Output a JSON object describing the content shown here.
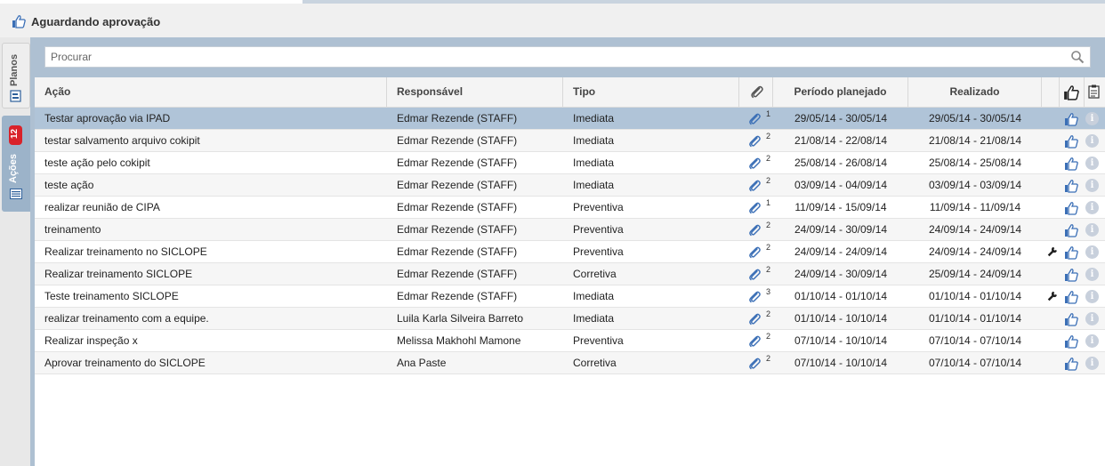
{
  "header": {
    "title": "Aguardando aprovação"
  },
  "sidebar": {
    "tabs": [
      {
        "label": "Planos",
        "icon": "plan-doc-icon",
        "active": false
      },
      {
        "label": "Ações",
        "badge": "12",
        "icon": "list-card-icon",
        "active": true
      }
    ]
  },
  "search": {
    "placeholder": "Procurar",
    "value": ""
  },
  "table": {
    "columns": {
      "acao": "Ação",
      "responsavel": "Responsável",
      "tipo": "Tipo",
      "anexo": "paperclip-icon",
      "periodo": "Período planejado",
      "realizado": "Realizado",
      "aprovar": "thumbs-up-icon",
      "relatorio": "clipboard-icon"
    },
    "rows": [
      {
        "acao": "Testar aprovação via IPAD",
        "responsavel": "Edmar Rezende (STAFF)",
        "tipo": "Imediata",
        "anexos": "1",
        "periodo": "29/05/14 - 30/05/14",
        "realizado": "29/05/14 - 30/05/14",
        "wrench": false,
        "selected": true
      },
      {
        "acao": "testar salvamento arquivo cokipit",
        "responsavel": "Edmar Rezende (STAFF)",
        "tipo": "Imediata",
        "anexos": "2",
        "periodo": "21/08/14 - 22/08/14",
        "realizado": "21/08/14 - 21/08/14",
        "wrench": false,
        "selected": false
      },
      {
        "acao": "teste ação pelo cokipit",
        "responsavel": "Edmar Rezende (STAFF)",
        "tipo": "Imediata",
        "anexos": "2",
        "periodo": "25/08/14 - 26/08/14",
        "realizado": "25/08/14 - 25/08/14",
        "wrench": false,
        "selected": false
      },
      {
        "acao": "teste ação",
        "responsavel": "Edmar Rezende (STAFF)",
        "tipo": "Imediata",
        "anexos": "2",
        "periodo": "03/09/14 - 04/09/14",
        "realizado": "03/09/14 - 03/09/14",
        "wrench": false,
        "selected": false
      },
      {
        "acao": "realizar reunião de CIPA",
        "responsavel": "Edmar Rezende (STAFF)",
        "tipo": "Preventiva",
        "anexos": "1",
        "periodo": "11/09/14 - 15/09/14",
        "realizado": "11/09/14 - 11/09/14",
        "wrench": false,
        "selected": false
      },
      {
        "acao": "treinamento",
        "responsavel": "Edmar Rezende (STAFF)",
        "tipo": "Preventiva",
        "anexos": "2",
        "periodo": "24/09/14 - 30/09/14",
        "realizado": "24/09/14 - 24/09/14",
        "wrench": false,
        "selected": false
      },
      {
        "acao": "Realizar treinamento no SICLOPE",
        "responsavel": "Edmar Rezende (STAFF)",
        "tipo": "Preventiva",
        "anexos": "2",
        "periodo": "24/09/14 - 24/09/14",
        "realizado": "24/09/14 - 24/09/14",
        "wrench": true,
        "selected": false
      },
      {
        "acao": "Realizar treinamento SICLOPE",
        "responsavel": "Edmar Rezende (STAFF)",
        "tipo": "Corretiva",
        "anexos": "2",
        "periodo": "24/09/14 - 30/09/14",
        "realizado": "25/09/14 - 24/09/14",
        "wrench": false,
        "selected": false
      },
      {
        "acao": "Teste treinamento SICLOPE",
        "responsavel": "Edmar Rezende (STAFF)",
        "tipo": "Imediata",
        "anexos": "3",
        "periodo": "01/10/14 - 01/10/14",
        "realizado": "01/10/14 - 01/10/14",
        "wrench": true,
        "selected": false
      },
      {
        "acao": "realizar treinamento com a equipe.",
        "responsavel": "Luila Karla Silveira Barreto",
        "tipo": "Imediata",
        "anexos": "2",
        "periodo": "01/10/14 - 10/10/14",
        "realizado": "01/10/14 - 01/10/14",
        "wrench": false,
        "selected": false
      },
      {
        "acao": "Realizar inspeção x",
        "responsavel": "Melissa Makhohl Mamone",
        "tipo": "Preventiva",
        "anexos": "2",
        "periodo": "07/10/14 - 10/10/14",
        "realizado": "07/10/14 - 07/10/14",
        "wrench": false,
        "selected": false
      },
      {
        "acao": "Aprovar treinamento do SICLOPE",
        "responsavel": "Ana Paste",
        "tipo": "Corretiva",
        "anexos": "2",
        "periodo": "07/10/14 - 10/10/14",
        "realizado": "07/10/14 - 07/10/14",
        "wrench": false,
        "selected": false
      }
    ]
  },
  "colors": {
    "panel": "#aec0d2",
    "selected_row": "#b0c4d8",
    "badge": "#d9222a",
    "like_icon": "#3b6fb6"
  }
}
